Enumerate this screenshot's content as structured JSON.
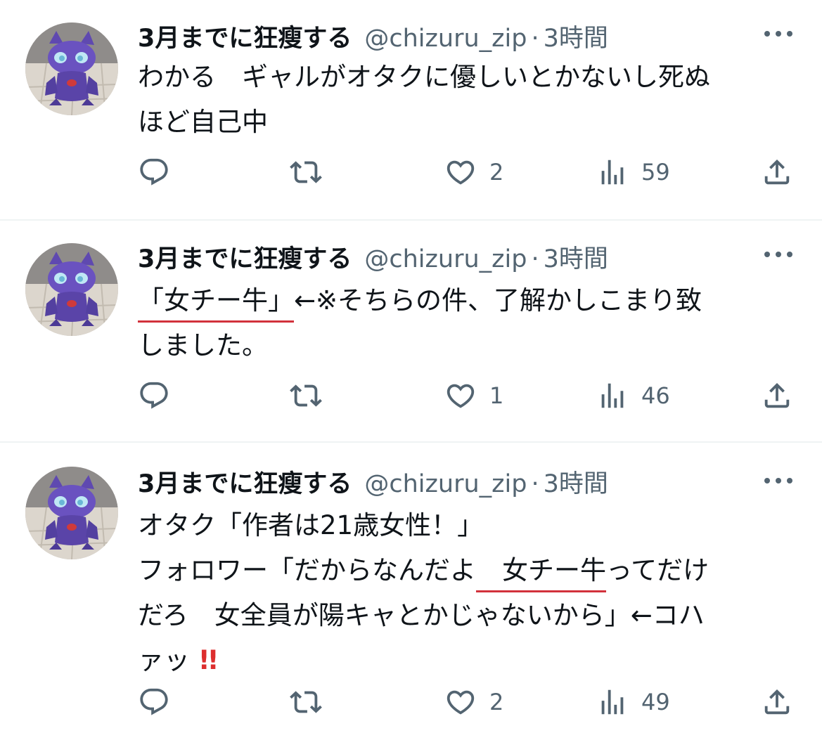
{
  "colors": {
    "text": "#0f1419",
    "secondary": "#536471",
    "divider": "#eff3f4",
    "underline": "#d2323c",
    "emoji_red": "#dd2e2e"
  },
  "icons": [
    "reply-icon",
    "retweet-icon",
    "like-icon",
    "views-icon",
    "share-icon",
    "more-icon"
  ],
  "tweets": [
    {
      "name": "3月までに狂瘦する",
      "handle": "@chizuru_zip",
      "separator": "·",
      "time": "3時間",
      "lines": [
        "わかる　ギャルがオタクに優しいとかないし死ぬ",
        "ほど自己中"
      ],
      "likes": "2",
      "views": "59"
    },
    {
      "name": "3月までに狂瘦する",
      "handle": "@chizuru_zip",
      "separator": "·",
      "time": "3時間",
      "line1_underlined": "「女チー牛」",
      "line1_rest": "←※そちらの件、了解かしこまり致",
      "line2": "しました。",
      "likes": "1",
      "views": "46"
    },
    {
      "name": "3月までに狂瘦する",
      "handle": "@chizuru_zip",
      "separator": "·",
      "time": "3時間",
      "line1": "オタク「作者は21歳女性！」",
      "line2_before": "フォロワー「だからなんだよ",
      "line2_underlined": "　女チー牛",
      "line2_after": "ってだけ",
      "line3": "だろ　女全員が陽キャとかじゃないから」←コハ",
      "line4": "ァッ",
      "line4_emoji": "!!",
      "likes": "2",
      "views": "49"
    }
  ]
}
